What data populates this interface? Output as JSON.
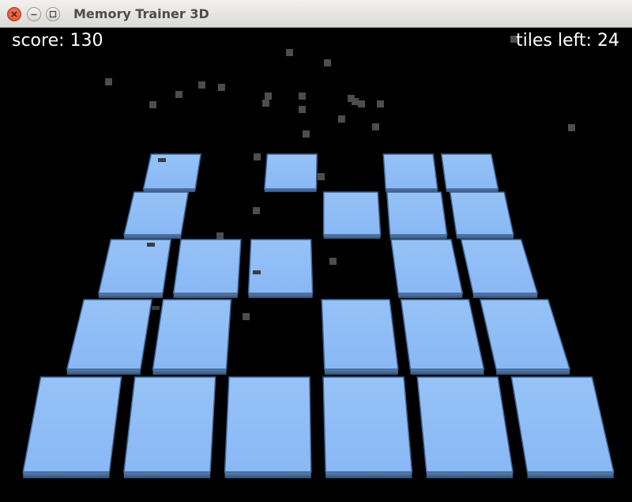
{
  "window": {
    "title": "Memory Trainer 3D",
    "buttons": {
      "close": "close-icon",
      "minimize": "minimize-icon",
      "maximize": "maximize-icon"
    }
  },
  "hud": {
    "score_text": "score: 130",
    "tiles_left_text": "tiles left: 24"
  },
  "board": {
    "tile_color": "#8ab8f5",
    "tile_edge_color": "#2e4f7a",
    "rows": 5,
    "cols": 6,
    "layout": [
      [
        1,
        0,
        1,
        0,
        1,
        1
      ],
      [
        1,
        0,
        0,
        1,
        1,
        1
      ],
      [
        1,
        1,
        1,
        0,
        1,
        1
      ],
      [
        1,
        1,
        0,
        1,
        1,
        1
      ],
      [
        1,
        1,
        1,
        1,
        1,
        1
      ]
    ]
  },
  "colors": {
    "background": "#000000",
    "particle": "#4d4d4d",
    "hud_text": "#ffffff"
  }
}
